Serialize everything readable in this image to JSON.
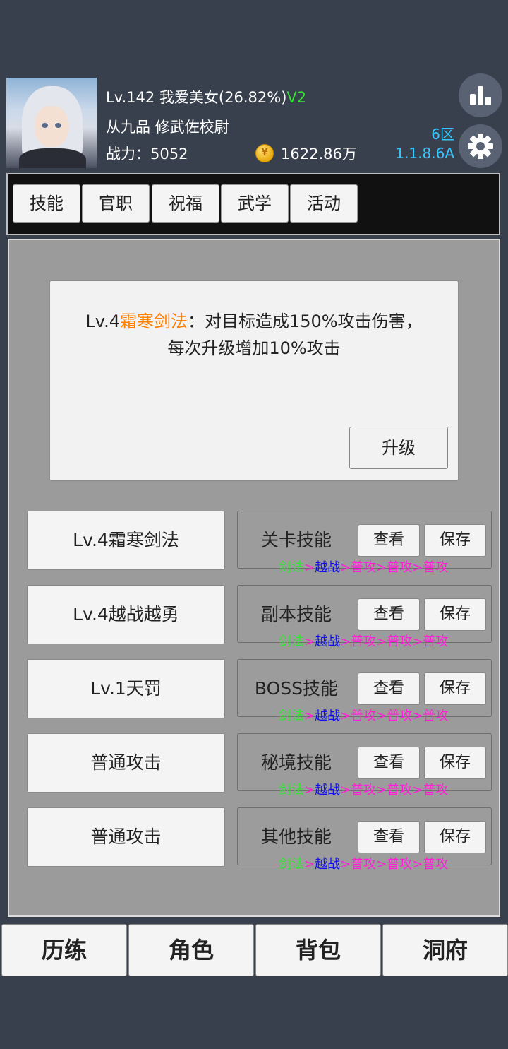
{
  "player": {
    "level_name": "Lv.142 我爱美女(26.82%)",
    "vip": "V2",
    "rank": "从九品 修武佐校尉",
    "power_label": "战力：",
    "power_value": "5052",
    "gold": "1622.86万",
    "server": "6区",
    "version": "1.1.8.6A"
  },
  "icons": {
    "chart": "bar-chart-icon",
    "settings": "gear-icon",
    "coin": "coin-icon"
  },
  "tabs": [
    "技能",
    "官职",
    "祝福",
    "武学",
    "活动"
  ],
  "description": {
    "level": "Lv.4",
    "skill": "霜寒剑法",
    "line1_rest": "：对目标造成150%攻击伤害，",
    "line2": "每次升级增加10%攻击",
    "upgrade_label": "升级"
  },
  "skill_slots": [
    "Lv.4霜寒剑法",
    "Lv.4越战越勇",
    "Lv.1天罚",
    "普通攻击",
    "普通攻击"
  ],
  "categories": [
    {
      "label": "关卡技能",
      "view": "查看",
      "save": "保存",
      "seq": [
        "剑法",
        ">",
        "越战",
        ">",
        "普攻",
        ">",
        "普攻",
        ">",
        "普攻"
      ]
    },
    {
      "label": "副本技能",
      "view": "查看",
      "save": "保存",
      "seq": [
        "剑法",
        ">",
        "越战",
        ">",
        "普攻",
        ">",
        "普攻",
        ">",
        "普攻"
      ]
    },
    {
      "label": "BOSS技能",
      "view": "查看",
      "save": "保存",
      "seq": [
        "剑法",
        ">",
        "越战",
        ">",
        "普攻",
        ">",
        "普攻",
        ">",
        "普攻"
      ]
    },
    {
      "label": "秘境技能",
      "view": "查看",
      "save": "保存",
      "seq": [
        "剑法",
        ">",
        "越战",
        ">",
        "普攻",
        ">",
        "普攻",
        ">",
        "普攻"
      ]
    },
    {
      "label": "其他技能",
      "view": "查看",
      "save": "保存",
      "seq": [
        "剑法",
        ">",
        "越战",
        ">",
        "普攻",
        ">",
        "普攻",
        ">",
        "普攻"
      ]
    }
  ],
  "bottom_nav": [
    "历练",
    "角色",
    "背包",
    "洞府"
  ],
  "colors": {
    "skill_highlight": "#ff7f00",
    "vip": "#36e236",
    "server_text": "#35c8ff",
    "seq_green": "#38e138",
    "seq_blue": "#1010ee",
    "seq_magenta": "#ff1fd8"
  }
}
